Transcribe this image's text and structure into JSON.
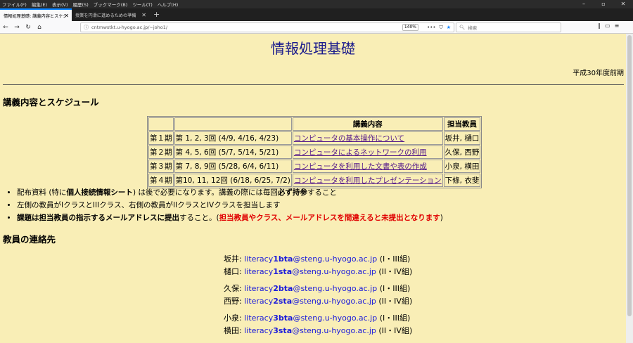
{
  "menubar": {
    "items": [
      "ファイル(F)",
      "編集(E)",
      "表示(V)",
      "履歴(S)",
      "ブックマーク(B)",
      "ツール(T)",
      "ヘルプ(H)"
    ]
  },
  "tabs": [
    {
      "title": "情報処理基礎: 講義内容とスケジュール"
    },
    {
      "title": "授業を円滑に進めるための準備"
    }
  ],
  "navbar": {
    "url": "cntmwstkt.u-hyogo.ac.jp/~joho1/",
    "zoom": "140%",
    "search_placeholder": "検索"
  },
  "page": {
    "title": "情報処理基礎",
    "term": "平成30年度前期",
    "schedule_heading": "講義内容とスケジュール",
    "table": {
      "headers": [
        "",
        "",
        "講義内容",
        "担当教員"
      ],
      "rows": [
        {
          "period": "第１期",
          "sessions": "第 1, 2, 3回 (4/9, 4/16, 4/23)",
          "topic": "コンピュータの基本操作について",
          "teachers": "坂井, 樋口"
        },
        {
          "period": "第２期",
          "sessions": "第 4, 5, 6回 (5/7, 5/14, 5/21)",
          "topic": "コンピュータによるネットワークの利用",
          "teachers": "久保, 西野"
        },
        {
          "period": "第３期",
          "sessions": "第 7, 8, 9回 (5/28, 6/4, 6/11)",
          "topic": "コンピュータを利用した文書や表の作成",
          "teachers": "小泉, 横田"
        },
        {
          "period": "第４期",
          "sessions": "第10, 11, 12回 (6/18, 6/25, 7/2)",
          "topic": "コンピュータを利用したプレゼンテーション",
          "teachers": "下條, 衣斐"
        }
      ]
    },
    "notes": {
      "n1_a": "配布資料 (特に",
      "n1_b": "個人接続情報シート",
      "n1_c": ") は後で必要になります。講義の際には毎回",
      "n1_d": "必ず持参",
      "n1_e": "すること",
      "n2": "左側の教員がIクラスとIIIクラス、右側の教員がIIクラスとIVクラスを担当します",
      "n3_a": "課題は担当教員の指示するメールアドレスに提出",
      "n3_b": "すること。(",
      "n3_c": "担当教員やクラス、メールアドレスを間違えると未提出となります",
      "n3_d": ")"
    },
    "contacts_heading": "教員の連絡先",
    "contacts": [
      {
        "name": "坂井:",
        "user_a": "literacy",
        "user_b": "1bta",
        "domain": "@steng.u-hyogo.ac.jp",
        "classes": "(I・III組)"
      },
      {
        "name": "樋口:",
        "user_a": "literacy",
        "user_b": "1sta",
        "domain": "@steng.u-hyogo.ac.jp",
        "classes": "(II・IV組)"
      },
      {
        "name": "久保:",
        "user_a": "literacy",
        "user_b": "2bta",
        "domain": "@steng.u-hyogo.ac.jp",
        "classes": "(I・III組)"
      },
      {
        "name": "西野:",
        "user_a": "literacy",
        "user_b": "2sta",
        "domain": "@steng.u-hyogo.ac.jp",
        "classes": "(II・IV組)"
      },
      {
        "name": "小泉:",
        "user_a": "literacy",
        "user_b": "3bta",
        "domain": "@steng.u-hyogo.ac.jp",
        "classes": "(I・III組)"
      },
      {
        "name": "横田:",
        "user_a": "literacy",
        "user_b": "3sta",
        "domain": "@steng.u-hyogo.ac.jp",
        "classes": "(II・IV組)"
      }
    ]
  }
}
